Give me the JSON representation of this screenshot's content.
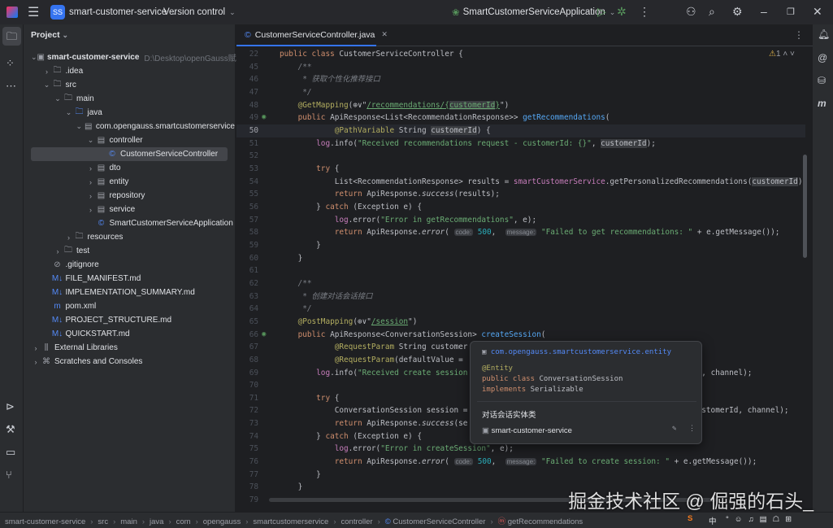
{
  "titlebar": {
    "project_badge": "SS",
    "project_name": "smart-customer-service",
    "vcs": "Version control",
    "run_config": "SmartCustomerServiceApplication"
  },
  "project_panel": {
    "title": "Project",
    "tree": [
      {
        "label": "smart-customer-service",
        "path": "D:\\Desktop\\openGauss赋能",
        "depth": 0,
        "chev": "v",
        "icon": "module",
        "bold": true
      },
      {
        "label": ".idea",
        "depth": 1,
        "chev": ">",
        "icon": "folder"
      },
      {
        "label": "src",
        "depth": 1,
        "chev": "v",
        "icon": "folder"
      },
      {
        "label": "main",
        "depth": 2,
        "chev": "v",
        "icon": "folder"
      },
      {
        "label": "java",
        "depth": 3,
        "chev": "v",
        "icon": "folder-blue"
      },
      {
        "label": "com.opengauss.smartcustomerservice",
        "depth": 4,
        "chev": "v",
        "icon": "package"
      },
      {
        "label": "controller",
        "depth": 5,
        "chev": "v",
        "icon": "package"
      },
      {
        "label": "CustomerServiceController",
        "depth": 6,
        "chev": "",
        "icon": "class",
        "selected": true
      },
      {
        "label": "dto",
        "depth": 5,
        "chev": ">",
        "icon": "package"
      },
      {
        "label": "entity",
        "depth": 5,
        "chev": ">",
        "icon": "package"
      },
      {
        "label": "repository",
        "depth": 5,
        "chev": ">",
        "icon": "package"
      },
      {
        "label": "service",
        "depth": 5,
        "chev": ">",
        "icon": "package"
      },
      {
        "label": "SmartCustomerServiceApplication",
        "depth": 5,
        "chev": "",
        "icon": "class"
      },
      {
        "label": "resources",
        "depth": 3,
        "chev": ">",
        "icon": "folder"
      },
      {
        "label": "test",
        "depth": 2,
        "chev": ">",
        "icon": "folder"
      },
      {
        "label": ".gitignore",
        "depth": 1,
        "chev": "",
        "icon": "ignore"
      },
      {
        "label": "FILE_MANIFEST.md",
        "depth": 1,
        "chev": "",
        "icon": "md"
      },
      {
        "label": "IMPLEMENTATION_SUMMARY.md",
        "depth": 1,
        "chev": "",
        "icon": "md"
      },
      {
        "label": "pom.xml",
        "depth": 1,
        "chev": "",
        "icon": "maven"
      },
      {
        "label": "PROJECT_STRUCTURE.md",
        "depth": 1,
        "chev": "",
        "icon": "md"
      },
      {
        "label": "QUICKSTART.md",
        "depth": 1,
        "chev": "",
        "icon": "md"
      },
      {
        "label": "External Libraries",
        "depth": 0,
        "chev": ">",
        "icon": "lib"
      },
      {
        "label": "Scratches and Consoles",
        "depth": 0,
        "chev": ">",
        "icon": "scratch"
      }
    ]
  },
  "editor": {
    "tab": "CustomerServiceController.java",
    "warnings": "1",
    "current_line": "50",
    "lines": [
      {
        "n": "22",
        "s": [
          [
            "kw",
            "public class "
          ],
          [
            "",
            "CustomerServiceController {"
          ]
        ]
      },
      {
        "n": "45",
        "s": [
          [
            "cm",
            "    /**"
          ]
        ]
      },
      {
        "n": "46",
        "s": [
          [
            "cm",
            "     * 获取个性化推荐接口"
          ]
        ]
      },
      {
        "n": "47",
        "s": [
          [
            "cm",
            "     */"
          ]
        ]
      },
      {
        "n": "48",
        "s": [
          [
            "an",
            "    @GetMapping"
          ],
          [
            "",
            "(⊕∨\""
          ],
          [
            "st ul",
            "/recommendations/{"
          ],
          [
            "st ul hl",
            "customerId"
          ],
          [
            "st ul",
            "}"
          ],
          [
            "",
            "\")"
          ]
        ]
      },
      {
        "n": "49",
        "g": true,
        "s": [
          [
            "kw",
            "    public "
          ],
          [
            "",
            "ApiResponse<List<RecommendationResponse>> "
          ],
          [
            "fn",
            "getRecommendations"
          ],
          [
            "",
            "("
          ]
        ]
      },
      {
        "n": "50",
        "s": [
          [
            "an",
            "            @PathVariable "
          ],
          [
            "",
            "String "
          ],
          [
            "hl",
            "customerId"
          ],
          [
            "",
            ") {"
          ]
        ]
      },
      {
        "n": "51",
        "s": [
          [
            "fd",
            "        log"
          ],
          [
            "",
            ".info("
          ],
          [
            "st",
            "\"Received recommendations request - customerId: {}\""
          ],
          [
            "",
            ", "
          ],
          [
            "hl",
            "customerId"
          ],
          [
            "",
            ");"
          ]
        ]
      },
      {
        "n": "52",
        "s": []
      },
      {
        "n": "53",
        "s": [
          [
            "kw",
            "        try "
          ],
          [
            "",
            "{"
          ]
        ]
      },
      {
        "n": "54",
        "s": [
          [
            "",
            "            List<RecommendationResponse> results = "
          ],
          [
            "fd",
            "smartCustomerService"
          ],
          [
            "",
            ".getPersonalizedRecommendations("
          ],
          [
            "hl",
            "customerId"
          ],
          [
            "",
            ");"
          ]
        ]
      },
      {
        "n": "55",
        "s": [
          [
            "kw",
            "            return "
          ],
          [
            "",
            "ApiResponse."
          ],
          [
            "it",
            "success"
          ],
          [
            "",
            "(results);"
          ]
        ]
      },
      {
        "n": "56",
        "s": [
          [
            "",
            "        } "
          ],
          [
            "kw",
            "catch "
          ],
          [
            "",
            "(Exception e) {"
          ]
        ]
      },
      {
        "n": "57",
        "s": [
          [
            "fd",
            "            log"
          ],
          [
            "",
            ".error("
          ],
          [
            "st",
            "\"Error in getRecommendations\""
          ],
          [
            "",
            ", e);"
          ]
        ]
      },
      {
        "n": "58",
        "s": [
          [
            "kw",
            "            return "
          ],
          [
            "",
            "ApiResponse."
          ],
          [
            "it",
            "error"
          ],
          [
            "",
            "( "
          ],
          [
            "hint",
            "code:"
          ],
          [
            "nu",
            " 500"
          ],
          [
            "",
            ",  "
          ],
          [
            "hint",
            "message:"
          ],
          [
            "st",
            " \"Failed to get recommendations: \""
          ],
          [
            "",
            " + e.getMessage());"
          ]
        ]
      },
      {
        "n": "59",
        "s": [
          [
            "",
            "        }"
          ]
        ]
      },
      {
        "n": "60",
        "s": [
          [
            "",
            "    }"
          ]
        ]
      },
      {
        "n": "61",
        "s": []
      },
      {
        "n": "62",
        "s": [
          [
            "cm",
            "    /**"
          ]
        ]
      },
      {
        "n": "63",
        "s": [
          [
            "cm",
            "     * 创建对话会话接口"
          ]
        ]
      },
      {
        "n": "64",
        "s": [
          [
            "cm",
            "     */"
          ]
        ]
      },
      {
        "n": "65",
        "s": [
          [
            "an",
            "    @PostMapping"
          ],
          [
            "",
            "(⊕∨\""
          ],
          [
            "st ul",
            "/session"
          ],
          [
            "",
            "\")"
          ]
        ]
      },
      {
        "n": "66",
        "g": true,
        "s": [
          [
            "kw",
            "    public "
          ],
          [
            "",
            "ApiResponse<ConversationSession> "
          ],
          [
            "fn",
            "createSession"
          ],
          [
            "",
            "("
          ]
        ]
      },
      {
        "n": "67",
        "s": [
          [
            "an",
            "            @RequestParam "
          ],
          [
            "",
            "String customer"
          ]
        ]
      },
      {
        "n": "68",
        "s": [
          [
            "an",
            "            @RequestParam"
          ],
          [
            "",
            "(defaultValue = "
          ]
        ]
      },
      {
        "n": "69",
        "s": [
          [
            "fd",
            "        log"
          ],
          [
            "",
            ".info("
          ],
          [
            "st",
            "\"Received create session"
          ],
          [
            "",
            "                                                  d, channel);"
          ]
        ]
      },
      {
        "n": "70",
        "s": []
      },
      {
        "n": "71",
        "s": [
          [
            "kw",
            "        try "
          ],
          [
            "",
            "{"
          ]
        ]
      },
      {
        "n": "72",
        "s": [
          [
            "",
            "            ConversationSession session =                                                   stomerId, channel);"
          ]
        ]
      },
      {
        "n": "73",
        "s": [
          [
            "kw",
            "            return "
          ],
          [
            "",
            "ApiResponse."
          ],
          [
            "it",
            "success"
          ],
          [
            "",
            "(se"
          ]
        ]
      },
      {
        "n": "74",
        "s": [
          [
            "",
            "        } "
          ],
          [
            "kw",
            "catch "
          ],
          [
            "",
            "(Exception e) {"
          ]
        ]
      },
      {
        "n": "75",
        "s": [
          [
            "fd",
            "            log"
          ],
          [
            "",
            ".error("
          ],
          [
            "st",
            "\"Error in createSession\""
          ],
          [
            "",
            ", e);"
          ]
        ]
      },
      {
        "n": "76",
        "s": [
          [
            "kw",
            "            return "
          ],
          [
            "",
            "ApiResponse."
          ],
          [
            "it",
            "error"
          ],
          [
            "",
            "( "
          ],
          [
            "hint",
            "code:"
          ],
          [
            "nu",
            " 500"
          ],
          [
            "",
            ",  "
          ],
          [
            "hint",
            "message:"
          ],
          [
            "st",
            " \"Failed to create session: \""
          ],
          [
            "",
            " + e.getMessage());"
          ]
        ]
      },
      {
        "n": "77",
        "s": [
          [
            "",
            "        }"
          ]
        ]
      },
      {
        "n": "78",
        "s": [
          [
            "",
            "    }"
          ]
        ]
      },
      {
        "n": "79",
        "s": []
      }
    ]
  },
  "popup": {
    "package": "com.opengauss.smartcustomerservice.entity",
    "annotation": "@Entity",
    "decl_kw": "public class",
    "decl_name": "ConversationSession",
    "impl_kw": "implements",
    "impl_name": "Serializable",
    "doc": "对话会话实体类",
    "module": "smart-customer-service"
  },
  "statusbar": {
    "breadcrumbs": [
      "smart-customer-service",
      "src",
      "main",
      "java",
      "com",
      "opengauss",
      "smartcustomerservice",
      "controller",
      "CustomerServiceController",
      "getRecommendations"
    ],
    "ime": "中"
  },
  "watermark": "掘金技术社区 @ 倔强的石头_",
  "colors": {
    "accent": "#3574f0",
    "keyword": "#cf8e6d",
    "string": "#6aab73",
    "annotation": "#b3ae60"
  }
}
